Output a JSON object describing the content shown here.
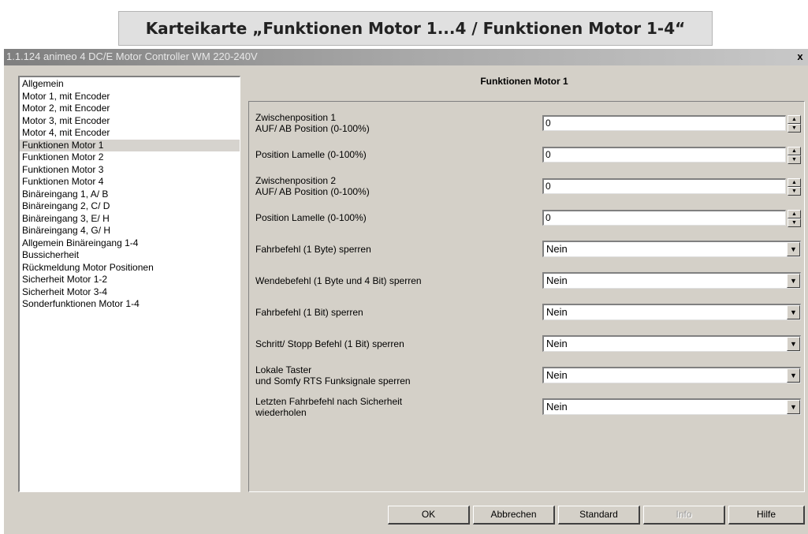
{
  "caption": "Karteikarte „Funktionen Motor 1...4 / Funktionen Motor 1-4“",
  "window": {
    "title": "1.1.124 animeo 4 DC/E Motor Controller WM 220-240V",
    "close_label": "x"
  },
  "nav": {
    "items": [
      "Allgemein",
      "Motor 1, mit Encoder",
      "Motor 2, mit Encoder",
      "Motor 3, mit Encoder",
      "Motor 4, mit Encoder",
      "Funktionen Motor 1",
      "Funktionen Motor 2",
      "Funktionen Motor 3",
      "Funktionen Motor 4",
      "Binäreingang 1, A/ B",
      "Binäreingang 2, C/ D",
      "Binäreingang 3, E/ H",
      "Binäreingang 4, G/ H",
      "Allgemein Binäreingang 1-4",
      "Bussicherheit",
      "Rückmeldung Motor Positionen",
      "Sicherheit Motor 1-2",
      "Sicherheit Motor 3-4",
      "Sonderfunktionen Motor 1-4"
    ],
    "selected": "Funktionen Motor 1"
  },
  "panel": {
    "title": "Funktionen Motor 1",
    "params": [
      {
        "line1": "Zwischenposition 1",
        "line2": "AUF/ AB Position (0-100%)",
        "value": "0"
      },
      {
        "line1": "Position Lamelle (0-100%)",
        "line2": "",
        "value": "0"
      },
      {
        "line1": "Zwischenposition 2",
        "line2": "AUF/ AB Position (0-100%)",
        "value": "0"
      },
      {
        "line1": "Position Lamelle (0-100%)",
        "line2": "",
        "value": "0"
      },
      {
        "line1": "Fahrbefehl (1 Byte) sperren",
        "line2": "",
        "value": "Nein"
      },
      {
        "line1": "Wendebefehl (1 Byte und 4 Bit) sperren",
        "line2": "",
        "value": "Nein"
      },
      {
        "line1": "Fahrbefehl (1 Bit) sperren",
        "line2": "",
        "value": "Nein"
      },
      {
        "line1": "Schritt/ Stopp Befehl (1 Bit) sperren",
        "line2": "",
        "value": "Nein"
      },
      {
        "line1": "Lokale Taster",
        "line2": "und Somfy RTS Funksignale sperren",
        "value": "Nein"
      },
      {
        "line1": "Letzten Fahrbefehl nach Sicherheit",
        "line2": "wiederholen",
        "value": "Nein"
      }
    ]
  },
  "buttons": {
    "ok": "OK",
    "cancel": "Abbrechen",
    "standard": "Standard",
    "info": "Info",
    "help": "Hilfe"
  },
  "icons": {
    "spin_up": "triangle-up",
    "spin_down": "triangle-down",
    "dropdown": "triangle-down",
    "close": "x"
  }
}
